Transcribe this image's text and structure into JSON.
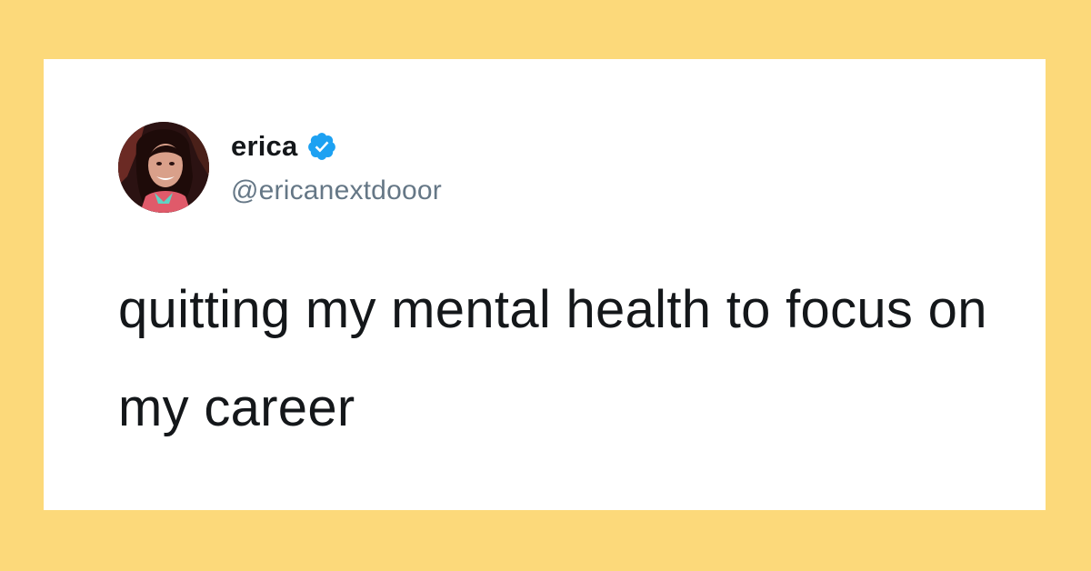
{
  "colors": {
    "background": "#fcd97a",
    "card": "#ffffff",
    "verified_badge": "#1da1f2",
    "handle": "#657786",
    "text": "#14171a"
  },
  "tweet": {
    "author": {
      "display_name": "erica",
      "handle": "@ericanextdooor",
      "verified": true,
      "verified_icon": "verified-badge-icon",
      "avatar_icon": "profile-photo"
    },
    "text": "quitting my mental health to focus on my career"
  }
}
